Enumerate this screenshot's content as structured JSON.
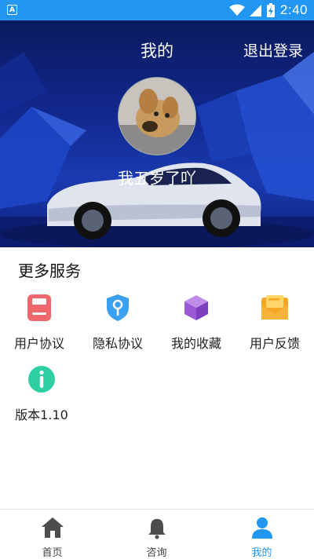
{
  "status_bar": {
    "time": "2:40",
    "app_icon": "A"
  },
  "header": {
    "title": "我的",
    "logout_label": "退出登录"
  },
  "profile": {
    "nickname": "我五岁了吖"
  },
  "services": {
    "title": "更多服务",
    "items": [
      {
        "label": "用户协议",
        "icon": "document-icon",
        "color": "#f0676b"
      },
      {
        "label": "隐私协议",
        "icon": "shield-key-icon",
        "color": "#3aa0ef"
      },
      {
        "label": "我的收藏",
        "icon": "cube-icon",
        "color": "#9b59d6"
      },
      {
        "label": "用户反馈",
        "icon": "mail-icon",
        "color": "#f5a623"
      },
      {
        "label": "版本1.10",
        "icon": "info-icon",
        "color": "#2ed0a3"
      }
    ]
  },
  "tabbar": {
    "items": [
      {
        "label": "首页",
        "icon": "home-icon",
        "active": false
      },
      {
        "label": "咨询",
        "icon": "bell-icon",
        "active": false
      },
      {
        "label": "我的",
        "icon": "user-icon",
        "active": true
      }
    ],
    "active_color": "#2196f3"
  }
}
